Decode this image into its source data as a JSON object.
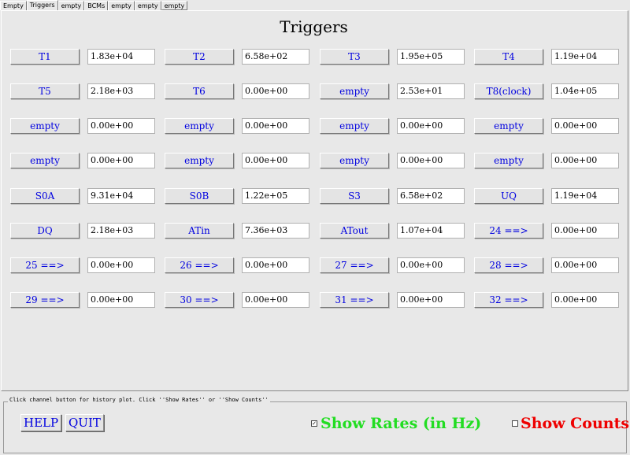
{
  "tabs": [
    "Empty",
    "Triggers",
    "empty",
    "BCMs",
    "empty",
    "empty",
    "empty"
  ],
  "title": "Triggers",
  "rows": [
    [
      {
        "label": "T1",
        "value": "1.83e+04"
      },
      {
        "label": "T2",
        "value": "6.58e+02"
      },
      {
        "label": "T3",
        "value": "1.95e+05"
      },
      {
        "label": "T4",
        "value": "1.19e+04"
      }
    ],
    [
      {
        "label": "T5",
        "value": "2.18e+03"
      },
      {
        "label": "T6",
        "value": "0.00e+00"
      },
      {
        "label": "empty",
        "value": "2.53e+01"
      },
      {
        "label": "T8(clock)",
        "value": "1.04e+05"
      }
    ],
    [
      {
        "label": "empty",
        "value": "0.00e+00"
      },
      {
        "label": "empty",
        "value": "0.00e+00"
      },
      {
        "label": "empty",
        "value": "0.00e+00"
      },
      {
        "label": "empty",
        "value": "0.00e+00"
      }
    ],
    [
      {
        "label": "empty",
        "value": "0.00e+00"
      },
      {
        "label": "empty",
        "value": "0.00e+00"
      },
      {
        "label": "empty",
        "value": "0.00e+00"
      },
      {
        "label": "empty",
        "value": "0.00e+00"
      }
    ],
    [
      {
        "label": "S0A",
        "value": "9.31e+04"
      },
      {
        "label": "S0B",
        "value": "1.22e+05"
      },
      {
        "label": "S3",
        "value": "6.58e+02"
      },
      {
        "label": "UQ",
        "value": "1.19e+04"
      }
    ],
    [
      {
        "label": "DQ",
        "value": "2.18e+03"
      },
      {
        "label": "ATin",
        "value": "7.36e+03"
      },
      {
        "label": "ATout",
        "value": "1.07e+04"
      },
      {
        "label": "24 ==>",
        "value": "0.00e+00"
      }
    ],
    [
      {
        "label": "25 ==>",
        "value": "0.00e+00"
      },
      {
        "label": "26 ==>",
        "value": "0.00e+00"
      },
      {
        "label": "27 ==>",
        "value": "0.00e+00"
      },
      {
        "label": "28 ==>",
        "value": "0.00e+00"
      }
    ],
    [
      {
        "label": "29 ==>",
        "value": "0.00e+00"
      },
      {
        "label": "30 ==>",
        "value": "0.00e+00"
      },
      {
        "label": "31 ==>",
        "value": "0.00e+00"
      },
      {
        "label": "32 ==>",
        "value": "0.00e+00"
      }
    ]
  ],
  "controls": {
    "hint": "Click channel button for history plot.  Click ''Show Rates'' or ''Show Counts''",
    "help_label": "HELP",
    "quit_label": "QUIT",
    "show_rates_label": "Show Rates (in Hz)",
    "show_rates_checked": true,
    "show_counts_label": "Show Counts",
    "show_counts_checked": false
  },
  "colors": {
    "button_text": "#0000e0",
    "rates_text": "#22dd22",
    "counts_text": "#ee0000"
  }
}
